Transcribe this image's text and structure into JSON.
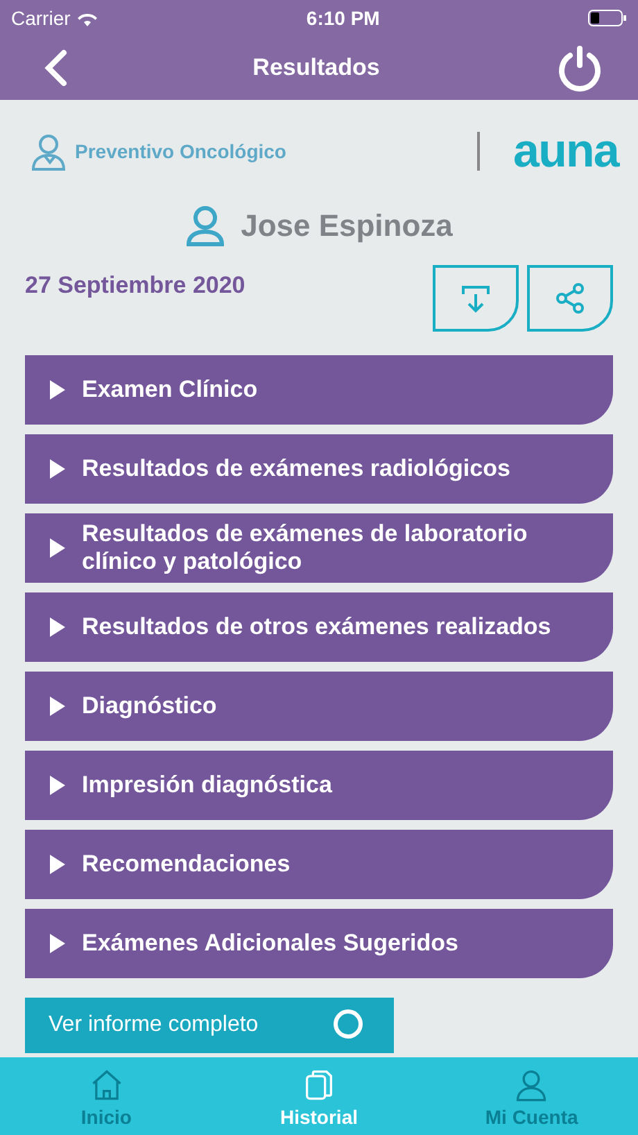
{
  "status_bar": {
    "carrier": "Carrier",
    "time": "6:10 PM"
  },
  "header": {
    "title": "Resultados"
  },
  "program": {
    "name": "Preventivo Oncológico",
    "brand": "auna"
  },
  "patient": {
    "name": "Jose Espinoza"
  },
  "date": "27 Septiembre 2020",
  "sections": [
    {
      "label": "Examen Clínico",
      "expanded": false
    },
    {
      "label": "Resultados de exámenes radiológicos",
      "expanded": false
    },
    {
      "label": "Resultados de exámenes de laboratorio clínico y patológico",
      "expanded": false
    },
    {
      "label": "Resultados de otros exámenes realizados",
      "expanded": false
    },
    {
      "label": "Diagnóstico",
      "expanded": false
    },
    {
      "label": "Impresión diagnóstica",
      "expanded": false
    },
    {
      "label": "Recomendaciones",
      "expanded": false
    },
    {
      "label": "Exámenes Adicionales Sugeridos",
      "expanded": false
    }
  ],
  "report_button": "Ver informe completo",
  "tab_bar": [
    {
      "label": "Inicio",
      "kind": "home",
      "selected": false
    },
    {
      "label": "Historial",
      "kind": "docs",
      "selected": true
    },
    {
      "label": "Mi Cuenta",
      "kind": "user",
      "selected": false
    }
  ]
}
